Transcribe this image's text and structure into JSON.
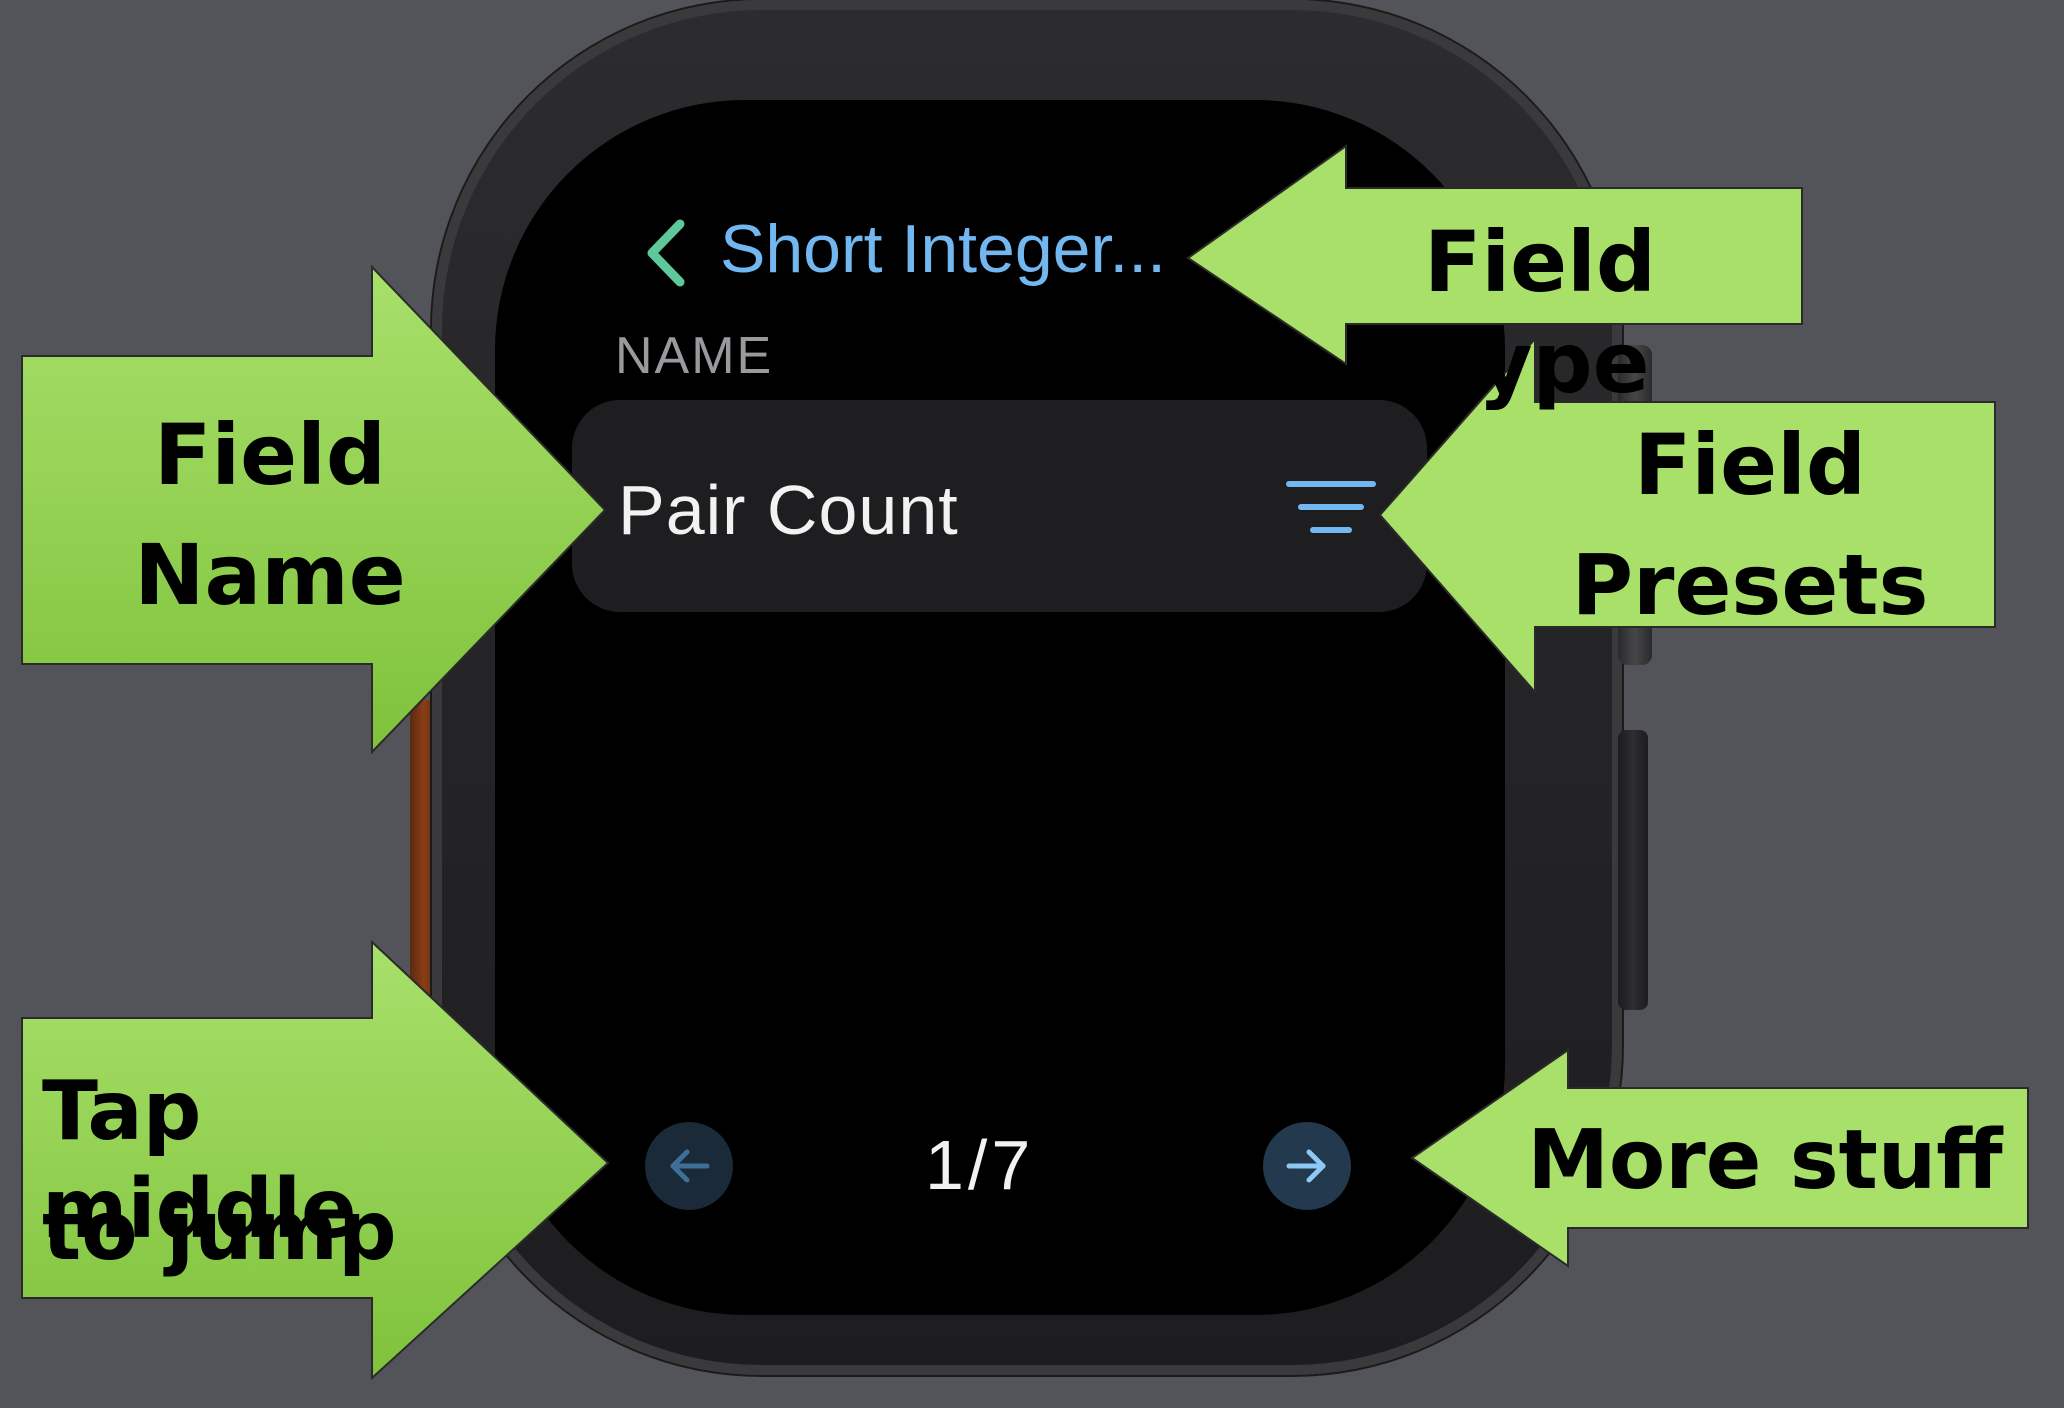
{
  "watch_screen": {
    "nav_title": "Short Integer...",
    "section_header": "NAME",
    "name_value": "Pair Count",
    "page_indicator": "1/7"
  },
  "callouts": {
    "field_type": "Field Type",
    "field_name_line1": "Field",
    "field_name_line2": "Name",
    "field_presets_line1": "Field",
    "field_presets_line2": "Presets",
    "jump_line1": "Tap middle",
    "jump_line2": "to jump",
    "more_stuff": "More stuff"
  },
  "colors": {
    "background": "#535459",
    "accent_blue": "#73b7f0",
    "back_chevron_green": "#5ec89a",
    "callout_green": "#a8e06a",
    "callout_green_dark": "#7fc23c"
  },
  "icons": {
    "back": "chevron-left-icon",
    "presets": "lines-list-icon",
    "previous": "arrow-left-icon",
    "next": "arrow-right-icon"
  }
}
